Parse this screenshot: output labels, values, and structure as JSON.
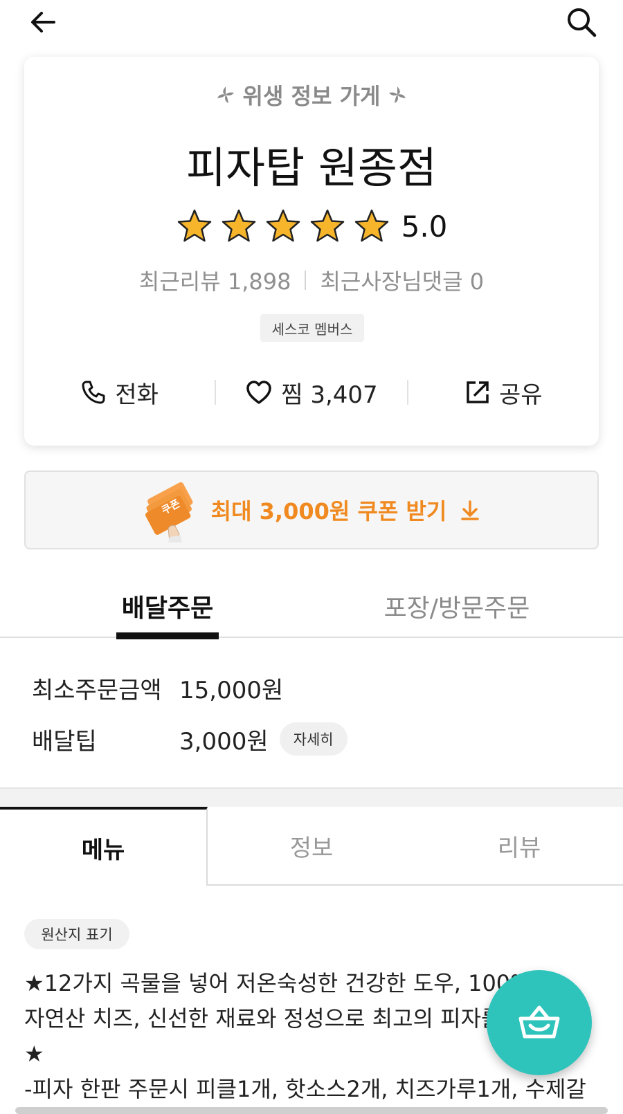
{
  "header": {
    "back_icon": "arrow-left-icon",
    "search_icon": "search-icon"
  },
  "store": {
    "hygiene_label": "위생 정보 가게",
    "name": "피자탑 원종점",
    "rating": "5.0",
    "stars": 5,
    "recent_reviews": "최근리뷰 1,898",
    "owner_comments": "최근사장님댓글 0",
    "membership_badge": "세스코 멤버스",
    "actions": {
      "call_label": "전화",
      "like_label": "찜 3,407",
      "share_label": "공유"
    }
  },
  "coupon": {
    "text": "최대 3,000원 쿠폰 받기",
    "image_label": "쿠폰",
    "accent_color": "#f08a20"
  },
  "order_tabs": [
    {
      "label": "배달주문",
      "active": true
    },
    {
      "label": "포장/방문주문",
      "active": false
    }
  ],
  "order_info": {
    "min_order_label": "최소주문금액",
    "min_order_value": "15,000원",
    "delivery_tip_label": "배달팁",
    "delivery_tip_value": "3,000원",
    "detail_button": "자세히"
  },
  "menu_tabs": [
    {
      "label": "메뉴",
      "active": true
    },
    {
      "label": "정보",
      "active": false
    },
    {
      "label": "리뷰",
      "active": false
    }
  ],
  "origin_chip": "원산지 표기",
  "description": "★12가지 곡물을 넣어 저온숙성한 건강한 도우, 100% 자연산 치즈, 신선한 재료와 정성으로 최고의 피자를 만듭니다★\n-피자 한판 주문시 피클1개, 핫소스2개, 치즈가루1개, 수제갈",
  "cart_button": {
    "icon": "shopping-basket-icon",
    "color": "#2ec4bb"
  }
}
